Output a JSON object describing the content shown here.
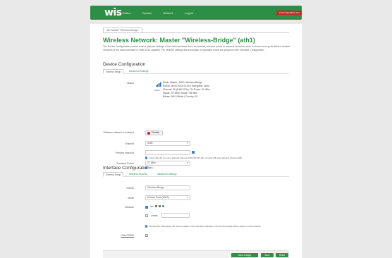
{
  "header": {
    "brand": "wis",
    "nav": [
      "Status",
      "System",
      "Network",
      "Logout"
    ],
    "badge": "AUTO REFRESH ON"
  },
  "breadcrumb": "wifi: Master \"Wireless-Bridge\"",
  "page": {
    "title": "Wireless Network: Master \"Wireless-Bridge\" (ath1)",
    "description": "The Device Configuration section covers physical settings of the radio hardware such as channel, transmit power or antenna selection which is shared among all defined wireless networks (if the radio hardware is multi-SSID capable). Per network settings like encryption or operation mode are grouped in the Interface Configuration."
  },
  "device": {
    "heading": "Device Configuration",
    "tabs": [
      "General Setup",
      "Advanced Settings"
    ],
    "status_label": "Status",
    "status_percent": "100%",
    "status_lines": [
      "Mode: Master | SSID: Wireless-Bridge",
      "BSSID: 00:00:00:00:11:00 | Encryption: None",
      "Channel: 36 (5.180 GHz) | Tx-Power: 20 dBm",
      "Signal: -67 dBm | Noise: -95 dBm",
      "Bitrate: 260.0 Mbit/s | Country: 00"
    ],
    "enabled_label": "Wireless network is enabled",
    "disable_button": "Disable",
    "channel_label": "Channel",
    "channel_value": "5180",
    "chanlist_label": "Primary chanList",
    "chanlist_hint": "Input 149-161 it means allowed channel 149,153,157,161 or input 185 only allowed channel 185",
    "txpower_label": "Transmit Power",
    "txpower_value": "17 dBm",
    "txpower_hint": "dBm"
  },
  "iface": {
    "heading": "Interface Configuration",
    "tabs": [
      "General Setup",
      "Wireless Security",
      "Advanced Settings"
    ],
    "essid_label": "ESSID",
    "essid_value": "Wireless-Bridge",
    "mode_label": "Mode",
    "mode_value": "Access Point (WDS)",
    "network_label": "Network",
    "network_item": "lan:",
    "create_label": "create:",
    "network_hint": "Choose the network(s) you want to attach to this wireless interface or fill out the create field to define a new network.",
    "hide_label": "Hide ESSID"
  },
  "footer": {
    "save_apply": "Save & Apply",
    "save": "Save",
    "reset": "Reset"
  },
  "colors": {
    "accent": "#2d8f46",
    "badge": "#c62828",
    "info": "#3f7fd0"
  }
}
